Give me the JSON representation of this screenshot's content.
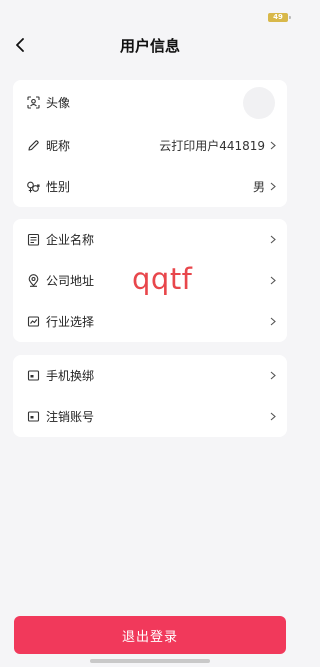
{
  "status_bar": {
    "battery": "49"
  },
  "header": {
    "title": "用户信息"
  },
  "profile": {
    "avatar_label": "头像",
    "nickname_label": "昵称",
    "nickname_value": "云打印用户441819",
    "gender_label": "性别",
    "gender_value": "男"
  },
  "company": {
    "name_label": "企业名称",
    "address_label": "公司地址",
    "industry_label": "行业选择"
  },
  "account": {
    "change_phone_label": "手机换绑",
    "cancel_account_label": "注销账号"
  },
  "watermark": "qqtf",
  "logout_label": "退出登录",
  "colors": {
    "accent": "#f1395b",
    "watermark": "#e8464b"
  }
}
